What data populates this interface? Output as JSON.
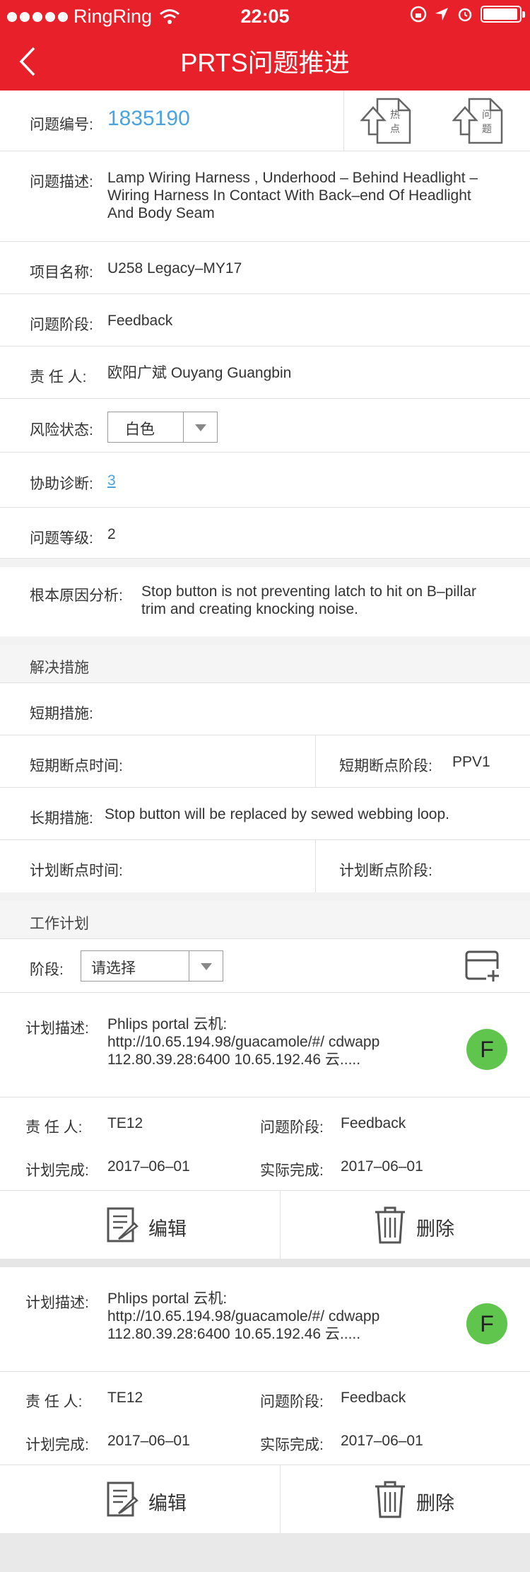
{
  "status_bar": {
    "carrier": "RingRing",
    "time": "22:05"
  },
  "nav": {
    "title": "PRTS问题推进"
  },
  "issue": {
    "number_label": "问题编号:",
    "number": "1835190",
    "upload_hotspot_label": [
      "热",
      "点"
    ],
    "upload_issue_label": [
      "问",
      "题"
    ]
  },
  "description": {
    "label": "问题描述:",
    "lines": [
      "Lamp Wiring Harness , Underhood – Behind Headlight –",
      "Wiring Harness In Contact With Back–end Of Headlight",
      "And Body Seam"
    ]
  },
  "project": {
    "label": "项目名称:",
    "value": "U258 Legacy–MY17"
  },
  "stage": {
    "label": "问题阶段:",
    "value": "Feedback"
  },
  "owner": {
    "label": "责 任 人:",
    "value": "欧阳广斌 Ouyang Guangbin"
  },
  "risk": {
    "label": "风险状态:",
    "value": "白色"
  },
  "assist": {
    "label": "协助诊断:",
    "value": "3"
  },
  "level": {
    "label": "问题等级:",
    "value": "2"
  },
  "root_cause": {
    "label": "根本原因分析:",
    "lines": [
      "Stop button is not preventing latch to hit on B–pillar",
      "trim and creating knocking noise."
    ]
  },
  "solution": {
    "header": "解决措施",
    "short_term_label": "短期措施:",
    "short_term_value": "",
    "short_breakpoint_time_label": "短期断点时间:",
    "short_breakpoint_stage_label": "短期断点阶段:",
    "short_breakpoint_stage_value": "PPV1",
    "long_term_label": "长期措施:",
    "long_term_value": "Stop button will be replaced by sewed webbing loop.",
    "plan_breakpoint_time_label": "计划断点时间:",
    "plan_breakpoint_stage_label": "计划断点阶段:"
  },
  "work_plan": {
    "header": "工作计划",
    "stage_label": "阶段:",
    "stage_select": "请选择",
    "plans": [
      {
        "desc_label": "计划描述:",
        "desc_lines": [
          "Phlips portal 云机:",
          "http://10.65.194.98/guacamole/#/ cdwapp",
          "112.80.39.28:6400 10.65.192.46 云....."
        ],
        "avatar": "F",
        "owner_label": "责 任 人:",
        "owner": "TE12",
        "stage_label": "问题阶段:",
        "stage": "Feedback",
        "plan_done_label": "计划完成:",
        "plan_done": "2017–06–01",
        "actual_done_label": "实际完成:",
        "actual_done": "2017–06–01",
        "edit_label": "编辑",
        "delete_label": "删除"
      },
      {
        "desc_label": "计划描述:",
        "desc_lines": [
          "Phlips portal 云机:",
          "http://10.65.194.98/guacamole/#/ cdwapp",
          "112.80.39.28:6400 10.65.192.46 云....."
        ],
        "avatar": "F",
        "owner_label": "责 任 人:",
        "owner": "TE12",
        "stage_label": "问题阶段:",
        "stage": "Feedback",
        "plan_done_label": "计划完成:",
        "plan_done": "2017–06–01",
        "actual_done_label": "实际完成:",
        "actual_done": "2017–06–01",
        "edit_label": "编辑",
        "delete_label": "删除"
      }
    ]
  },
  "colors": {
    "brand_red": "#e8202a",
    "link_blue": "#4aa3df",
    "avatar_green": "#5fc54c"
  }
}
